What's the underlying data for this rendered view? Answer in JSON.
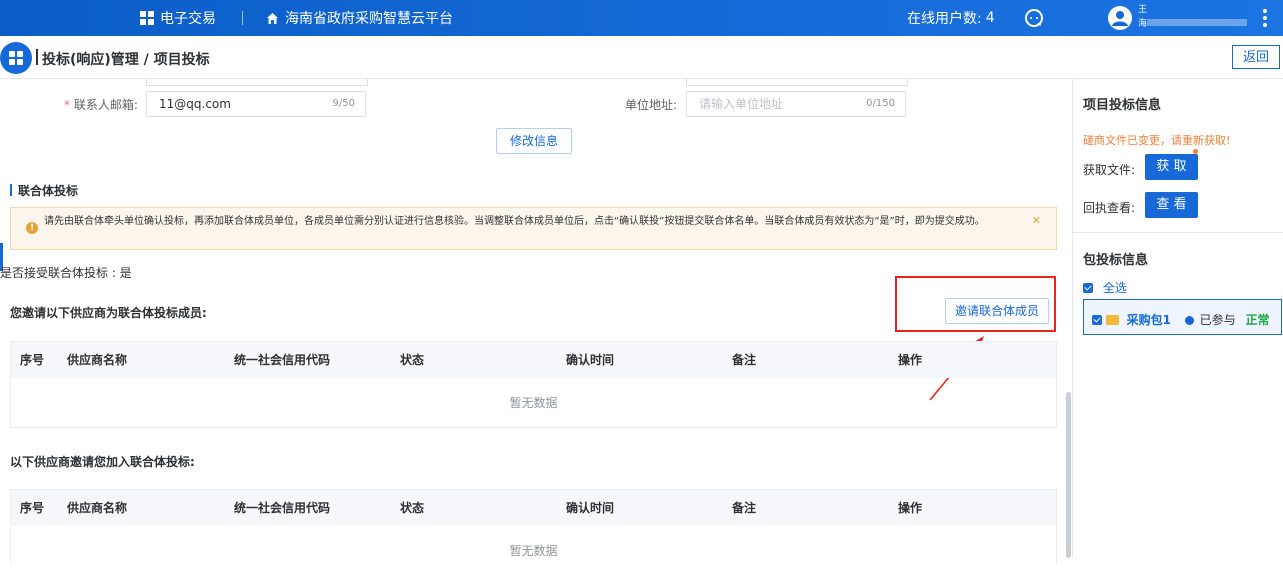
{
  "topbar": {
    "apps_label": "电子交易",
    "platform_name": "海南省政府采购智慧云平台",
    "online_label": "在线用户数:",
    "online_count": "4",
    "user_name": "王",
    "user_org": "海"
  },
  "header": {
    "title": "投标(响应)管理 / 项目投标",
    "back_label": "返回"
  },
  "form": {
    "email_label": "联系人邮箱:",
    "email_value": "11@qq.com",
    "email_count": "9/50",
    "address_label": "单位地址:",
    "address_placeholder": "请输入单位地址",
    "address_count": "0/150",
    "modify_label": "修改信息"
  },
  "consortium": {
    "section_title": "联合体投标",
    "alert_text": "请先由联合体牵头单位确认投标，再添加联合体成员单位，各成员单位需分别认证进行信息核验。当调整联合体成员单位后，点击“确认联投”按钮提交联合体名单。当联合体成员有效状态为“是”时，即为提交成功。",
    "accept_text": "是否接受联合体投标 : 是",
    "invited_title": "您邀请以下供应商为联合体投标成员:",
    "invite_button": "邀请联合体成员",
    "inviting_title": "以下供应商邀请您加入联合体投标:",
    "columns": [
      "序号",
      "供应商名称",
      "统一社会信用代码",
      "状态",
      "确认时间",
      "备注",
      "操作"
    ],
    "empty_text": "暂无数据"
  },
  "right_panel": {
    "project_title": "项目投标信息",
    "warning": "磋商文件已变更，请重新获取!",
    "fetch_label": "获取文件:",
    "fetch_button": "获 取",
    "receipt_label": "回执查看:",
    "view_button": "查 看",
    "package_title": "包投标信息",
    "select_all": "全选",
    "package_name": "采购包1",
    "package_status": "已参与",
    "package_state": "正常"
  },
  "colors": {
    "primary": "#1769d8",
    "warning": "#f2803c",
    "success": "#1ea644",
    "highlight": "#e8271c"
  }
}
